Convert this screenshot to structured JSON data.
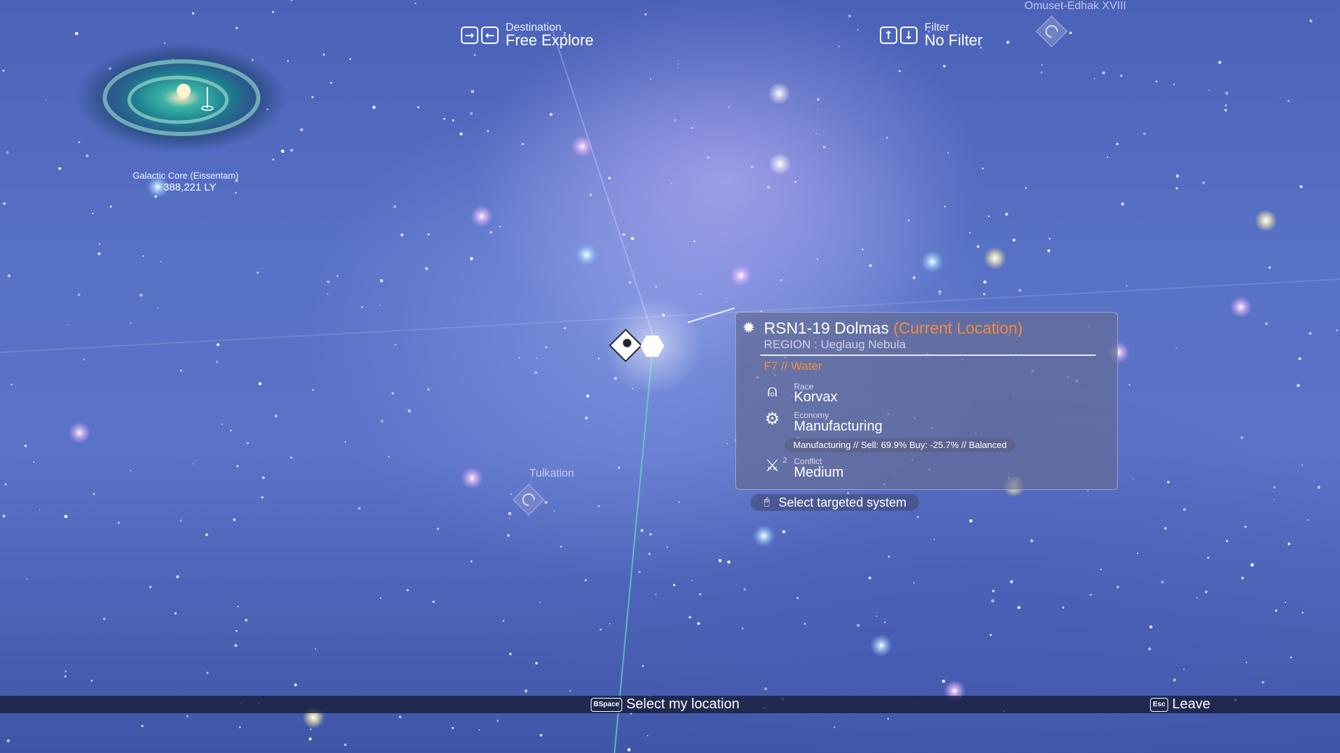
{
  "hud": {
    "destination": {
      "label": "Destination",
      "value": "Free Explore",
      "key_left": "→",
      "key_right": "←"
    },
    "filter": {
      "label": "Filter",
      "value": "No Filter",
      "key_up": "↑",
      "key_down": "↓"
    }
  },
  "galactic_core": {
    "name": "Galactic Core (Eissentam)",
    "distance": "388,221 LY"
  },
  "systems": {
    "north": "Omuset-Edhak XVIII",
    "nearby": "Tulkation"
  },
  "system_panel": {
    "name": "RSN1-19 Dolmas ",
    "current_location": "(Current Location)",
    "region": "REGION : Ueglaug Nebula",
    "classification": "F7 // Water",
    "race": {
      "label": "Race",
      "value": "Korvax"
    },
    "economy": {
      "label": "Economy",
      "value": "Manufacturing",
      "detail": "Manufacturing // Sell: 69.9% Buy: -25.7% // Balanced"
    },
    "conflict": {
      "label": "Conflict",
      "value": "Medium",
      "level": "2"
    }
  },
  "actions": {
    "select_targeted": "Select targeted system",
    "select_location": {
      "key": "BSpace",
      "label": "Select my location"
    },
    "leave": {
      "key": "Esc",
      "label": "Leave"
    }
  },
  "colors": {
    "accent_orange": "#f58b3b",
    "panel": "#646c96"
  }
}
